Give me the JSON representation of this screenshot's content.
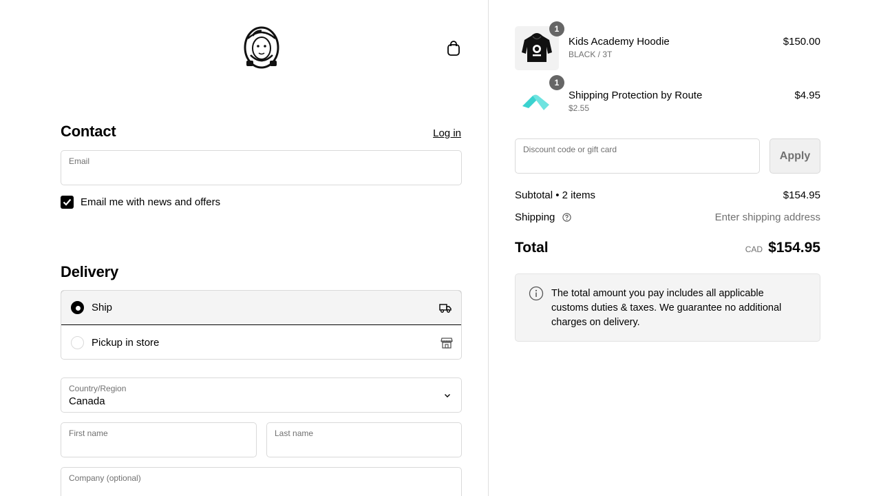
{
  "header": {
    "logo_icon": "astronaut-helmet-logo",
    "cart_icon": "shopping-bag-icon"
  },
  "contact": {
    "title": "Contact",
    "login_label": "Log in",
    "email_label": "Email",
    "email_value": "",
    "newsletter_label": "Email me with news and offers",
    "newsletter_checked": true
  },
  "delivery": {
    "title": "Delivery",
    "options": [
      {
        "label": "Ship",
        "icon": "truck-icon",
        "selected": true
      },
      {
        "label": "Pickup in store",
        "icon": "store-icon",
        "selected": false
      }
    ],
    "country_label": "Country/Region",
    "country_value": "Canada",
    "first_name_label": "First name",
    "last_name_label": "Last name",
    "company_label": "Company (optional)"
  },
  "order": {
    "items": [
      {
        "name": "Kids Academy Hoodie",
        "variant": "BLACK / 3T",
        "price": "$150.00",
        "qty": "1"
      },
      {
        "name": "Shipping Protection by Route",
        "variant": "$2.55",
        "price": "$4.95",
        "qty": "1"
      }
    ],
    "discount_placeholder": "Discount code or gift card",
    "apply_label": "Apply",
    "subtotal_label": "Subtotal • 2 items",
    "subtotal_value": "$154.95",
    "shipping_label": "Shipping",
    "shipping_value": "Enter shipping address",
    "total_label": "Total",
    "currency": "CAD",
    "total_value": "$154.95",
    "notice": "The total amount you pay includes all applicable customs duties & taxes. We guarantee no additional charges on delivery."
  },
  "colors": {
    "accent": "#000000",
    "muted_text": "#707070",
    "border": "#d9d9d9",
    "panel_bg": "#f4f4f4",
    "route_teal": "#3ad2cf"
  }
}
